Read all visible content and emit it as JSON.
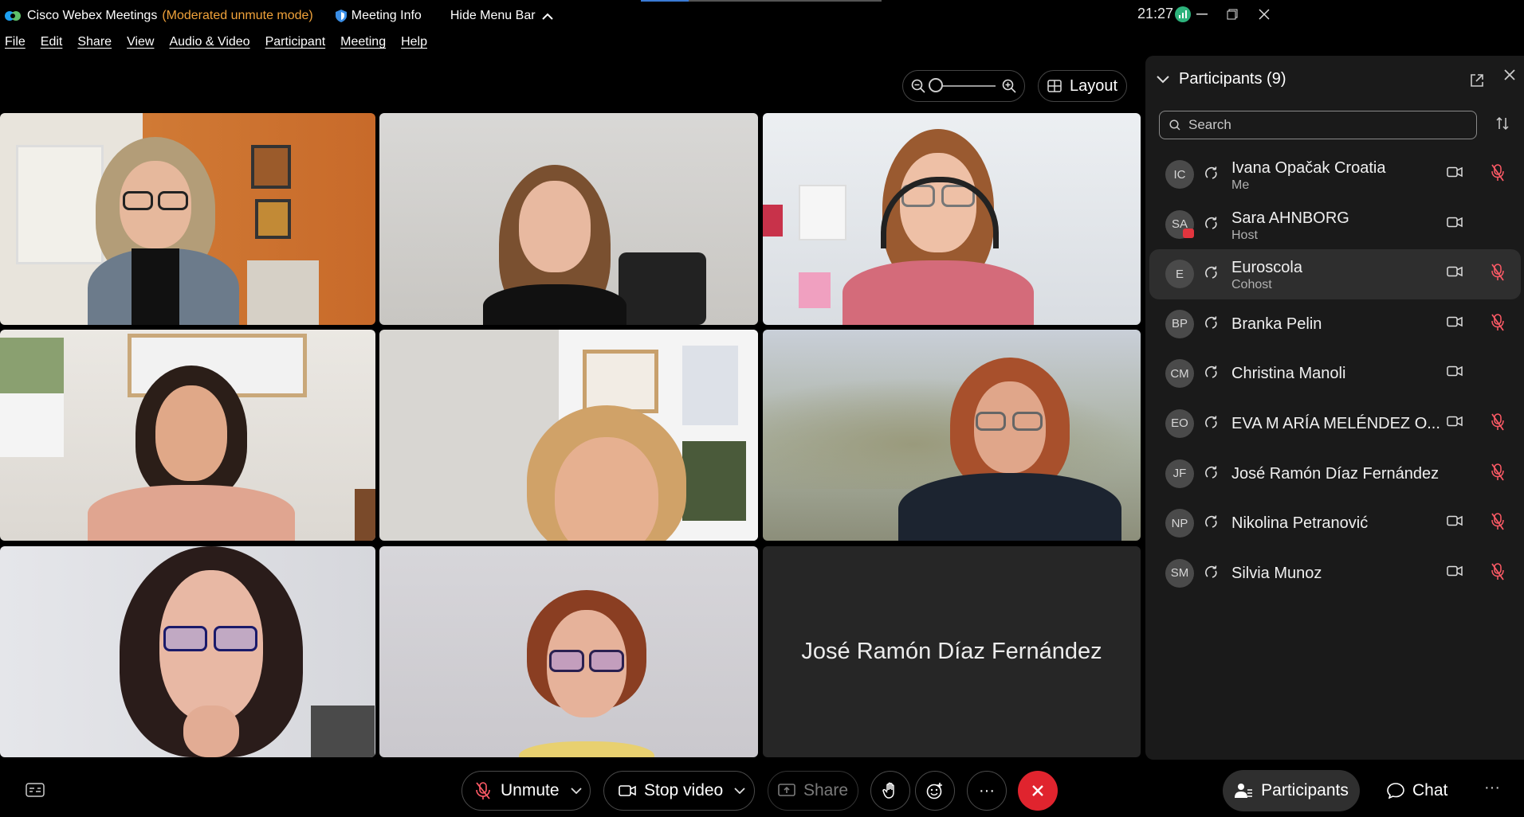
{
  "titlebar": {
    "app_name": "Cisco Webex Meetings",
    "mode": "(Moderated unmute mode)",
    "meeting_info": "Meeting Info",
    "hide_menu_bar": "Hide Menu Bar",
    "clock": "21:27",
    "icons": {
      "app": "webex-logo",
      "info": "shield-icon",
      "hide": "chevron-up-icon",
      "network": "signal-bars-icon"
    }
  },
  "menubar": {
    "items": [
      "File",
      "Edit",
      "Share",
      "View",
      "Audio & Video",
      "Participant",
      "Meeting",
      "Help"
    ]
  },
  "toolbar": {
    "layout_label": "Layout",
    "icons": {
      "zoom_out": "zoom-out-icon",
      "zoom_in": "zoom-in-icon",
      "layout": "grid-icon"
    },
    "zoom_level": 0
  },
  "video_grid": {
    "name_only_tile": "José Ramón Díaz Fernández",
    "tile_count": 9
  },
  "participants_panel": {
    "title": "Participants (9)",
    "search_placeholder": "Search",
    "participants": [
      {
        "initials": "IC",
        "name": "Ivana Opačak Croatia",
        "role": "Me",
        "video": true,
        "muted": true
      },
      {
        "initials": "SA",
        "name": "Sara AHNBORG",
        "role": "Host",
        "video": true,
        "muted": false,
        "badge": "presenter-badge"
      },
      {
        "initials": "E",
        "name": "Euroscola",
        "role": "Cohost",
        "video": true,
        "muted": true,
        "highlighted": true
      },
      {
        "initials": "BP",
        "name": "Branka Pelin",
        "role": "",
        "video": true,
        "muted": true
      },
      {
        "initials": "CM",
        "name": "Christina Manoli",
        "role": "",
        "video": true,
        "muted": false
      },
      {
        "initials": "EO",
        "name": "EVA M ARÍA MELÉNDEZ O...",
        "role": "",
        "video": true,
        "muted": true
      },
      {
        "initials": "JF",
        "name": "José Ramón Díaz Fernández",
        "role": "",
        "video": false,
        "muted": true
      },
      {
        "initials": "NP",
        "name": "Nikolina Petranović",
        "role": "",
        "video": true,
        "muted": true
      },
      {
        "initials": "SM",
        "name": "Silvia Munoz",
        "role": "",
        "video": true,
        "muted": true
      }
    ]
  },
  "controls": {
    "unmute": "Unmute",
    "stop_video": "Stop video",
    "share": "Share",
    "participants": "Participants",
    "chat": "Chat",
    "more": "···",
    "end_color": "#e0242e"
  }
}
